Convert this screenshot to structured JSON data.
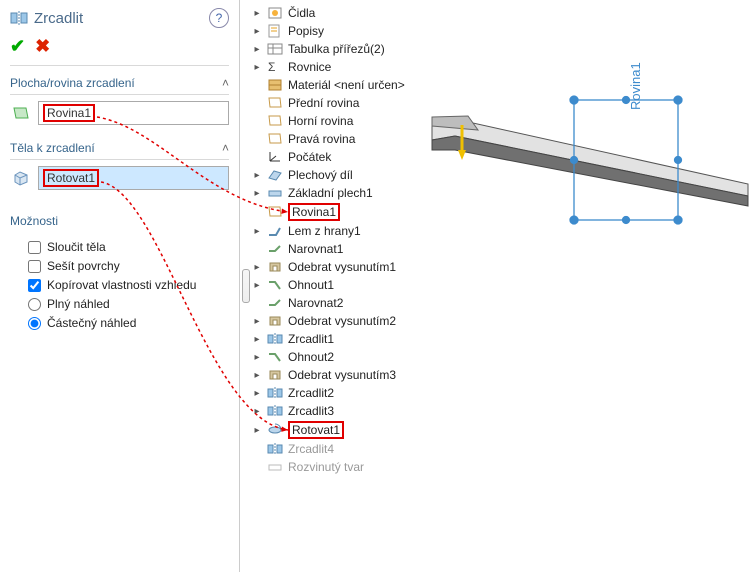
{
  "title": "Zrcadlit",
  "help": "?",
  "ok": "✔",
  "cancel": "✖",
  "sections": {
    "plane": {
      "label": "Plocha/rovina zrcadlení",
      "value": "Rovina1"
    },
    "bodies": {
      "label": "Těla k zrcadlení",
      "value": "Rotovat1"
    },
    "options": {
      "label": "Možnosti"
    }
  },
  "opts": {
    "merge": "Sloučit těla",
    "knit": "Sešít povrchy",
    "copy": "Kopírovat vlastnosti vzhledu",
    "full": "Plný náhled",
    "partial": "Částečný náhled"
  },
  "tree": [
    {
      "exp": "▸",
      "label": "Čidla"
    },
    {
      "exp": "▸",
      "label": "Popisy"
    },
    {
      "exp": "▸",
      "label": "Tabulka přířezů(2)"
    },
    {
      "exp": "▸",
      "label": "Rovnice"
    },
    {
      "exp": "",
      "label": "Materiál <není určen>"
    },
    {
      "exp": "",
      "label": "Přední rovina"
    },
    {
      "exp": "",
      "label": "Horní rovina"
    },
    {
      "exp": "",
      "label": "Pravá rovina"
    },
    {
      "exp": "",
      "label": "Počátek"
    },
    {
      "exp": "▸",
      "label": "Plechový díl"
    },
    {
      "exp": "▸",
      "label": "Základní plech1"
    },
    {
      "exp": "",
      "label": "Rovina1",
      "hl": true,
      "arrow": "src_plane"
    },
    {
      "exp": "▸",
      "label": "Lem z hrany1"
    },
    {
      "exp": "",
      "label": "Narovnat1"
    },
    {
      "exp": "▸",
      "label": "Odebrat vysunutím1"
    },
    {
      "exp": "▸",
      "label": "Ohnout1"
    },
    {
      "exp": "",
      "label": "Narovnat2"
    },
    {
      "exp": "▸",
      "label": "Odebrat vysunutím2"
    },
    {
      "exp": "▸",
      "label": "Zrcadlit1"
    },
    {
      "exp": "▸",
      "label": "Ohnout2"
    },
    {
      "exp": "▸",
      "label": "Odebrat vysunutím3"
    },
    {
      "exp": "▸",
      "label": "Zrcadlit2"
    },
    {
      "exp": "▸",
      "label": "Zrcadlit3"
    },
    {
      "exp": "▸",
      "label": "Rotovat1",
      "hl": true,
      "arrow": "src_body"
    },
    {
      "exp": "",
      "label": "Zrcadlit4",
      "dim": true
    },
    {
      "exp": "",
      "label": "Rozvinutý tvar",
      "dim": true
    }
  ],
  "viewport_plane_label": "Rovina1",
  "icons": {
    "mirror": "mirror-icon",
    "plane": "plane-icon",
    "body": "body-icon",
    "sensor": "sensor-icon",
    "note": "note-icon",
    "cutlist": "cutlist-icon",
    "equation": "equation-icon",
    "material": "material-icon",
    "origin": "origin-icon",
    "sheetmetal": "sheetmetal-icon",
    "baseflange": "baseflange-icon",
    "edgeflange": "edgeflange-icon",
    "unfold": "unfold-icon",
    "extrudecut": "extrudecut-icon",
    "fold": "fold-icon",
    "revolve": "revolve-icon",
    "flat": "flat-icon"
  },
  "colors": {
    "accent": "#3d8bcd",
    "annot": "#e00000"
  }
}
